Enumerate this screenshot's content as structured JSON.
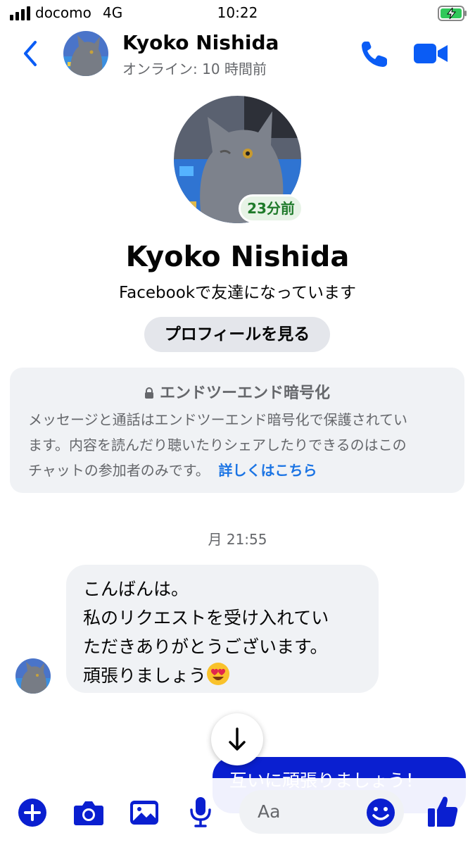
{
  "status_bar": {
    "carrier": "docomo",
    "network": "4G",
    "time": "10:22"
  },
  "header": {
    "contact_name": "Kyoko Nishida",
    "online_status": "オンライン: 10 時間前"
  },
  "profile": {
    "badge": "23分前",
    "name": "Kyoko Nishida",
    "friend_status": "Facebookで友達になっています",
    "view_profile_label": "プロフィールを見る"
  },
  "encryption": {
    "title": "エンドツーエンド暗号化",
    "body": "メッセージと通話はエンドツーエンド暗号化で保護されています。内容を読んだり聴いたりシェアしたりできるのはこのチャットの参加者のみです。",
    "body_lines": [
      "メッセージと通話はエンドツーエンド暗号化で保護されてい",
      "ます。内容を読んだり聴いたりシェアしたりできるのはこの",
      "チャットの参加者のみです。"
    ],
    "link": "詳しくはこちら"
  },
  "chat": {
    "timestamp": "月 21:55",
    "incoming_lines": [
      "こんばんは。",
      "私のリクエストを受け入れてい",
      "ただきありがとうございます。",
      "頑張りましょう"
    ],
    "outgoing_partial": "互いに頑張りましょう！"
  },
  "composer": {
    "placeholder": "Aa"
  },
  "colors": {
    "accent": "#0a1fd0",
    "icon_blue": "#0a5cf5",
    "bubble_gray": "#f0f2f5",
    "link_blue": "#1b74e4"
  },
  "icons": [
    "signal-icon",
    "battery-charging-icon",
    "back-chevron-icon",
    "phone-icon",
    "video-camera-icon",
    "lock-icon",
    "heart-eyes-emoji",
    "arrow-down-icon",
    "plus-icon",
    "camera-icon",
    "image-icon",
    "microphone-icon",
    "emoji-icon",
    "thumbs-up-icon"
  ]
}
